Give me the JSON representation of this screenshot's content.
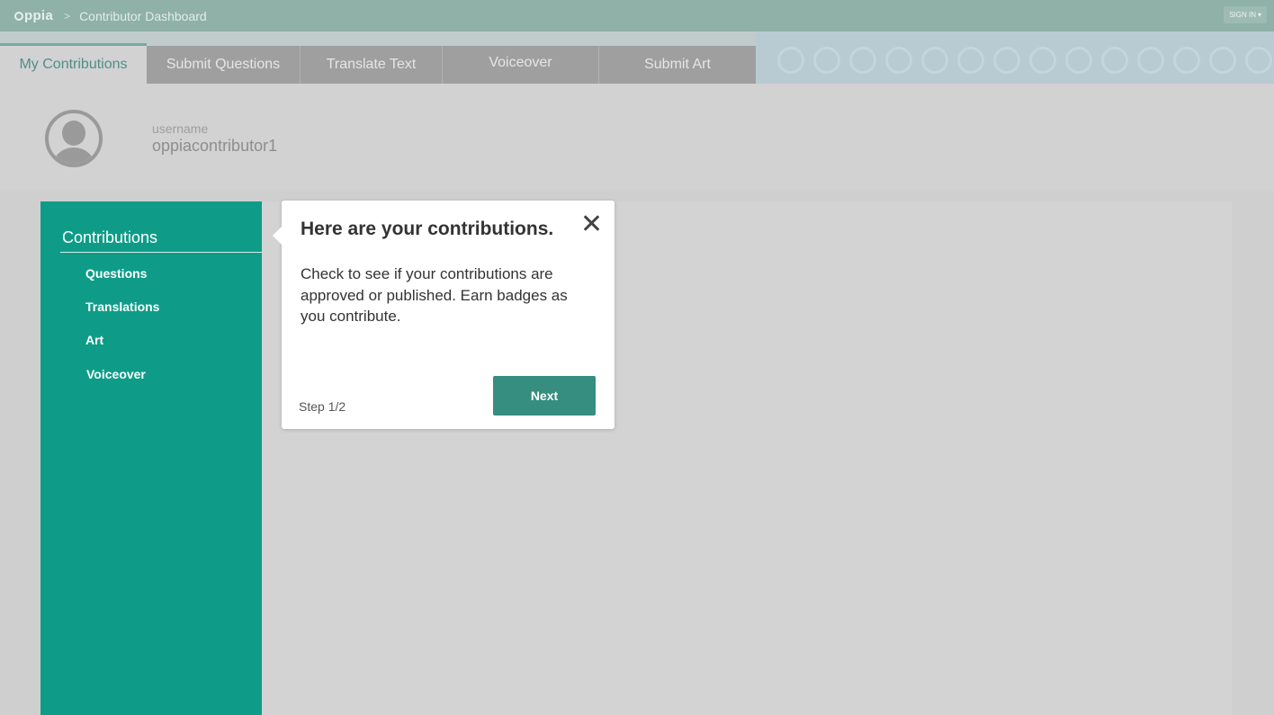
{
  "header": {
    "logo_text": "ppia",
    "logo_icon": "oppia-logo-icon",
    "breadcrumb_separator": ">",
    "breadcrumb": "Contributor Dashboard",
    "sign_in_label": "SIGN IN",
    "sign_in_icon": "caret-down-icon"
  },
  "tabs": [
    {
      "label": "My Contributions",
      "active": true
    },
    {
      "label": "Submit Questions",
      "active": false
    },
    {
      "label": "Translate Text",
      "active": false
    },
    {
      "label": "Voiceover",
      "active": false
    },
    {
      "label": "Submit Art",
      "active": false
    }
  ],
  "profile": {
    "username_label": "username",
    "username": "oppiacontributor1",
    "avatar_icon": "user-avatar-icon"
  },
  "sidebar": {
    "title": "Contributions",
    "items": [
      {
        "label": "Questions"
      },
      {
        "label": "Translations"
      },
      {
        "label": "Art"
      },
      {
        "label": "Voiceover"
      }
    ]
  },
  "tour": {
    "title": "Here are your contributions.",
    "body": "Check to see if your contributions are approved or published. Earn badges as you contribute.",
    "step": "Step 1/2",
    "next_label": "Next",
    "close_icon": "close-icon"
  },
  "colors": {
    "accent": "#0e9c88",
    "button": "#368e80",
    "topbar": "#8fb1a7"
  }
}
